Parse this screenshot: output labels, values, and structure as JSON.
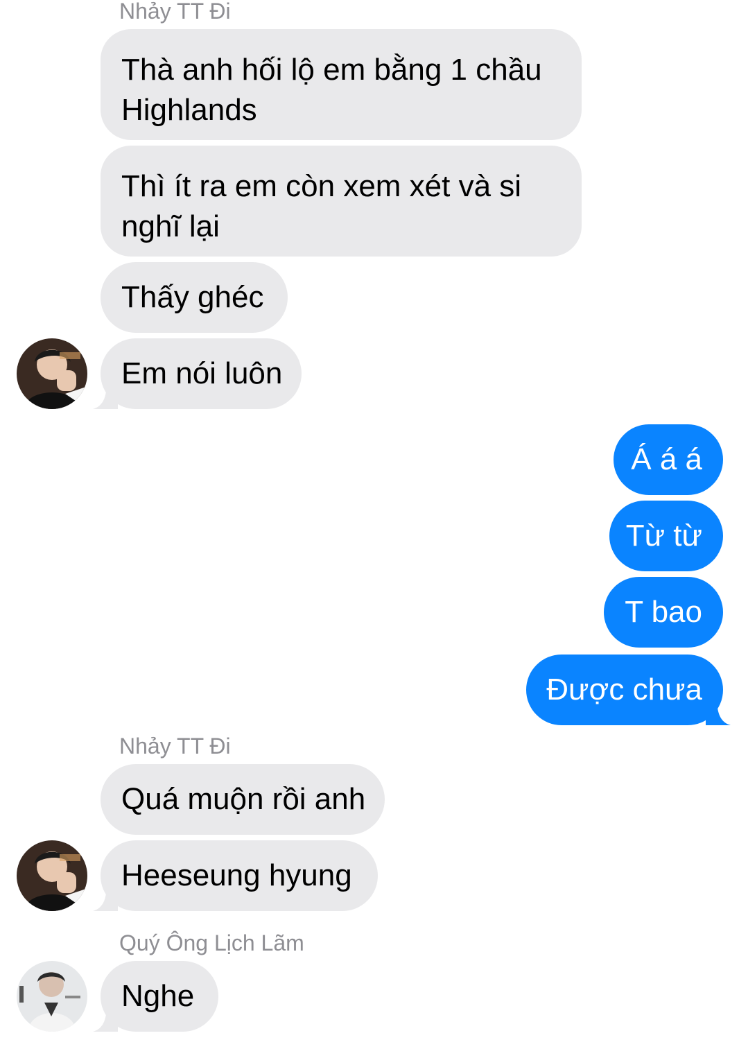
{
  "thread": {
    "groups": [
      {
        "sender": "Nhảy TT Đi",
        "messages": [
          "Thà anh hối lộ em bằng 1 chầu Highlands",
          "Thì ít ra em còn xem xét và si nghĩ lại",
          "Thấy ghéc",
          "Em nói luôn"
        ],
        "avatar_icon": "user-avatar-photo"
      },
      {
        "sender": "",
        "outgoing": true,
        "messages": [
          "Á á á",
          "Từ từ",
          "T bao",
          "Được chưa"
        ]
      },
      {
        "sender": "Nhảy TT Đi",
        "messages": [
          "Quá muộn rồi anh",
          "Heeseung hyung"
        ],
        "avatar_icon": "user-avatar-photo"
      },
      {
        "sender": "Quý Ông Lịch Lãm",
        "messages": [
          "Nghe"
        ],
        "avatar_icon": "user-avatar-photo"
      }
    ]
  },
  "colors": {
    "incoming_bubble": "#e9e9eb",
    "outgoing_bubble": "#0a84ff",
    "sender_name": "#8e8e93"
  }
}
